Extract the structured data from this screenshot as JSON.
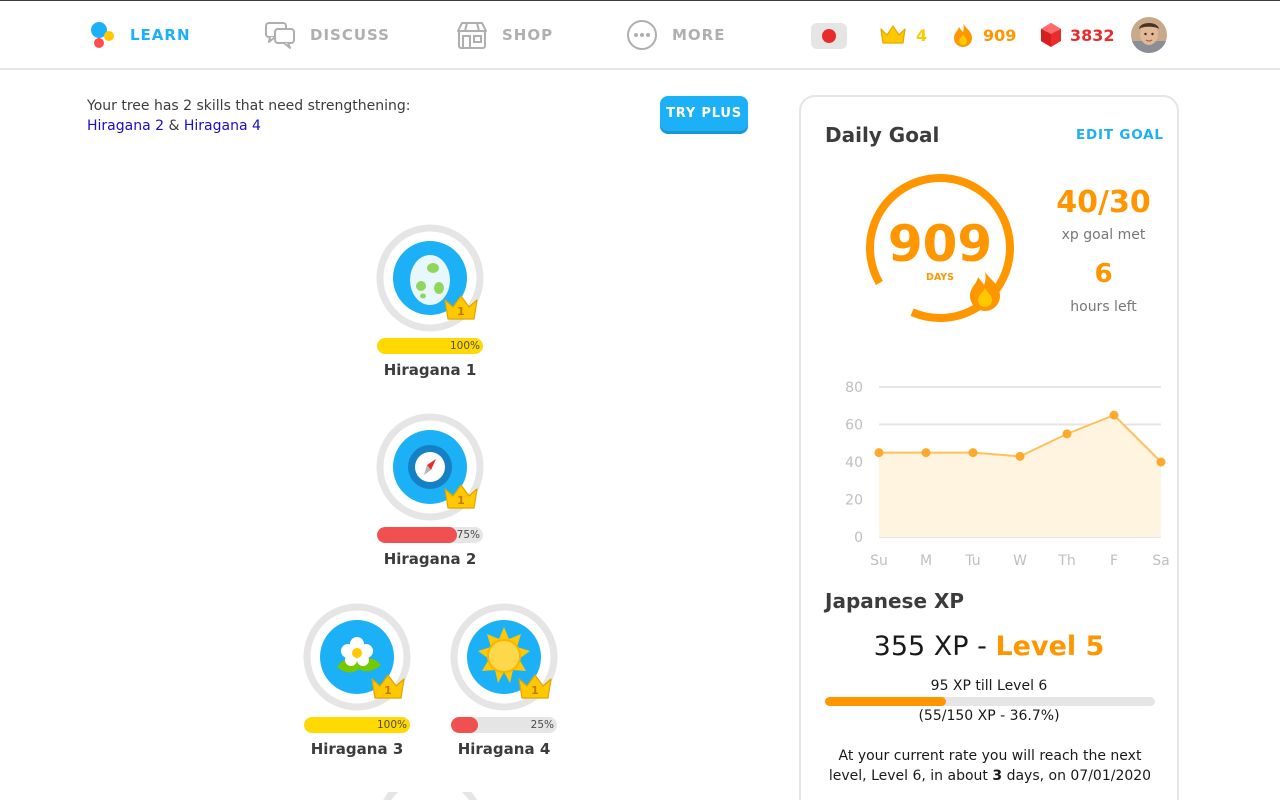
{
  "nav": {
    "learn": "LEARN",
    "discuss": "DISCUSS",
    "shop": "SHOP",
    "more": "MORE",
    "crowns": "4",
    "streak": "909",
    "gems": "3832"
  },
  "notice": {
    "text": "Your tree has 2 skills that need strengthening:",
    "link1": "Hiragana 2",
    "amp": "&",
    "link2": "Hiragana 4",
    "try_plus": "TRY PLUS"
  },
  "skills": [
    {
      "name": "Hiragana 1",
      "crown": "1",
      "progress": 100,
      "pct": "100%",
      "bar_color": "#ffd900",
      "icon": "egg-icon"
    },
    {
      "name": "Hiragana 2",
      "crown": "1",
      "progress": 75,
      "pct": "75%",
      "bar_color": "#f05050",
      "icon": "compass-icon"
    },
    {
      "name": "Hiragana 3",
      "crown": "1",
      "progress": 100,
      "pct": "100%",
      "bar_color": "#ffd900",
      "icon": "flower-icon"
    },
    {
      "name": "Hiragana 4",
      "crown": "1",
      "progress": 25,
      "pct": "25%",
      "bar_color": "#f05050",
      "icon": "sun-icon"
    }
  ],
  "daily_goal": {
    "title": "Daily Goal",
    "edit": "EDIT GOAL",
    "streak_days": "909",
    "days_label": "DAYS",
    "goal_value": "40/30",
    "goal_caption": "xp goal met",
    "hours_value": "6",
    "hours_caption": "hours left"
  },
  "chart_data": {
    "type": "area",
    "categories": [
      "Su",
      "M",
      "Tu",
      "W",
      "Th",
      "F",
      "Sa"
    ],
    "values": [
      45,
      45,
      45,
      43,
      55,
      65,
      40
    ],
    "ylim": [
      0,
      80
    ],
    "yticks": [
      "0",
      "20",
      "40",
      "60",
      "80"
    ],
    "grid": true,
    "line_color": "#ffc05a",
    "point_color": "#ffa82e",
    "fill_color": "#fff4e0"
  },
  "xp": {
    "title": "Japanese XP",
    "total": "355 XP -",
    "level": "Level 5",
    "till": "95 XP till Level 6",
    "progress": 0.367,
    "sub": "(55/150 XP - 36.7%)",
    "note_pre": "At your current rate you will reach the next level, Level 6, in about",
    "note_days": "3",
    "note_post": "days, on 07/01/2020"
  },
  "colors": {
    "accent": "#1cb0f6",
    "orange": "#ff9600",
    "gem": "#ea2b2b"
  }
}
